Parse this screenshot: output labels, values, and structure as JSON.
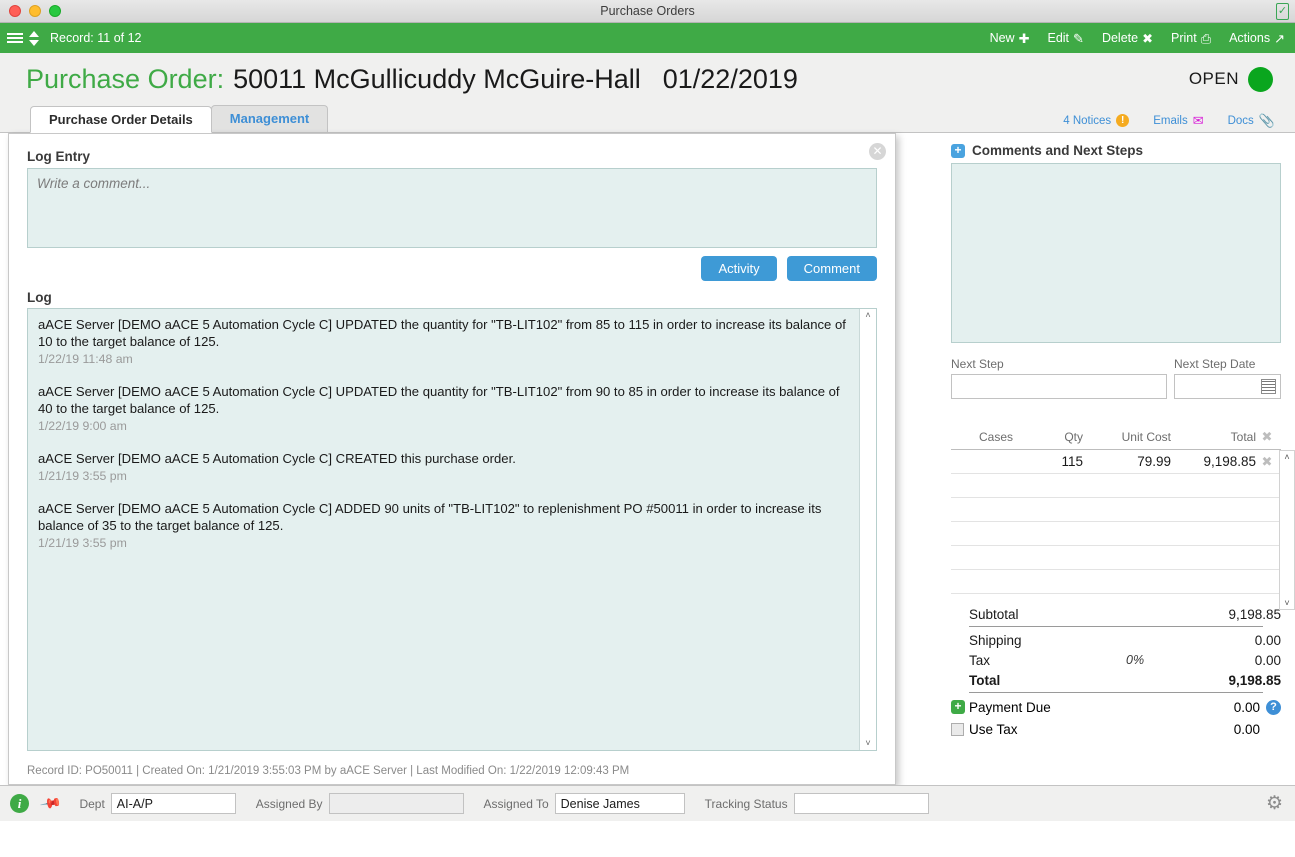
{
  "window": {
    "title": "Purchase Orders",
    "right_icon": "lock-icon"
  },
  "toolbar": {
    "record_label": "Record: 11 of 12",
    "actions": [
      {
        "label": "New",
        "icon": "plus-icon",
        "glyph": "✚"
      },
      {
        "label": "Edit",
        "icon": "pencil-icon",
        "glyph": "✎"
      },
      {
        "label": "Delete",
        "icon": "x-icon",
        "glyph": "✖"
      },
      {
        "label": "Print",
        "icon": "printer-icon",
        "glyph": "⎙"
      },
      {
        "label": "Actions",
        "icon": "arrow-icon",
        "glyph": "↗"
      }
    ]
  },
  "header": {
    "label": "Purchase Order:",
    "number_and_vendor": "50011 McGullicuddy McGuire-Hall",
    "date": "01/22/2019",
    "status": "OPEN",
    "status_color": "#0aa61e"
  },
  "tabs": [
    {
      "label": "Purchase Order Details",
      "active": true
    },
    {
      "label": "Management",
      "active": false
    }
  ],
  "tab_right_items": [
    {
      "label": "4 Notices",
      "icon": "warning-icon",
      "glyph": "!"
    },
    {
      "label": "Emails",
      "icon": "envelope-icon",
      "glyph": "✉"
    },
    {
      "label": "Docs",
      "icon": "paperclip-icon",
      "glyph": "📎"
    }
  ],
  "modal": {
    "close_label": "✕",
    "log_entry_label": "Log Entry",
    "comment_placeholder": "Write a comment...",
    "buttons": [
      {
        "label": "Activity"
      },
      {
        "label": "Comment"
      }
    ],
    "log_label": "Log",
    "log_entries": [
      {
        "text_pre": "aACE",
        "text": " Server [DEMO aACE 5 Automation Cycle C] UPDATED the quantity for \"TB-LIT102\" from 85 to 115 in order to increase its balance of 10 to the target balance of 125.",
        "full": "aACE Server [DEMO aACE 5 Automation Cycle C] UPDATED the quantity for \"TB-LIT102\" from 85 to 115 in order to increase its balance of 10 to the target balance of 125.",
        "timestamp": "1/22/19  11:48 am"
      },
      {
        "full": "aACE Server [DEMO aACE 5 Automation Cycle C] UPDATED the quantity for \"TB-LIT102\" from  90  to 85 in order to increase its balance of 40 to the target balance of 125.",
        "timestamp": "1/22/19  9:00 am"
      },
      {
        "full": "aACE Server [DEMO aACE 5 Automation Cycle C] CREATED this purchase order.",
        "timestamp": "1/21/19  3:55 pm"
      },
      {
        "full": "aACE Server [DEMO aACE 5 Automation Cycle C] ADDED 90 units of \"TB-LIT102\" to replenishment PO #50011 in order to increase its balance of 35 to the target balance of 125.",
        "timestamp": "1/21/19  3:55 pm"
      }
    ],
    "scroll_up": "˄",
    "scroll_down": "˅",
    "record_footer": "Record ID: PO50011  |  Created On: 1/21/2019 3:55:03 PM by aACE Server  |  Last Modified On: 1/22/2019 12:09:43 PM"
  },
  "comments_panel": {
    "title": "Comments and Next Steps",
    "add_glyph": "+",
    "body_value": "",
    "next_step_label": "Next Step",
    "next_step_value": "",
    "next_step_date_label": "Next Step Date",
    "next_step_date_value": "",
    "calendar_icon": "calendar-icon"
  },
  "line_items": {
    "columns": [
      "Cases",
      "Qty",
      "Unit Cost",
      "Total"
    ],
    "delete_glyph": "✖",
    "rows": [
      {
        "cases": "",
        "qty": "115",
        "unit_cost": "79.99",
        "total": "9,198.85"
      },
      {
        "cases": "",
        "qty": "",
        "unit_cost": "",
        "total": ""
      },
      {
        "cases": "",
        "qty": "",
        "unit_cost": "",
        "total": ""
      },
      {
        "cases": "",
        "qty": "",
        "unit_cost": "",
        "total": ""
      },
      {
        "cases": "",
        "qty": "",
        "unit_cost": "",
        "total": ""
      },
      {
        "cases": "",
        "qty": "",
        "unit_cost": "",
        "total": ""
      }
    ],
    "scroll_up": "˄",
    "scroll_down": "˅"
  },
  "totals": {
    "subtotal_label": "Subtotal",
    "subtotal_value": "9,198.85",
    "shipping_label": "Shipping",
    "shipping_value": "0.00",
    "tax_label": "Tax",
    "tax_rate": "0%",
    "tax_value": "0.00",
    "total_label": "Total",
    "total_value": "9,198.85",
    "payment_due_label": "Payment Due",
    "payment_due_value": "0.00",
    "use_tax_label": "Use Tax",
    "use_tax_value": "0.00",
    "help_glyph": "?"
  },
  "bottom_bar": {
    "info_glyph": "i",
    "pin_icon": "pin-icon",
    "dept_label": "Dept",
    "dept_value": "AI-A/P",
    "assigned_by_label": "Assigned By",
    "assigned_by_value": "",
    "assigned_to_label": "Assigned To",
    "assigned_to_value": "Denise James",
    "tracking_status_label": "Tracking Status",
    "tracking_status_value": "",
    "gear_icon": "gear-icon",
    "gear_glyph": "⚙"
  },
  "colors": {
    "toolbar_green": "#3faa46",
    "accent_blue": "#3e9ad6",
    "panel_teal": "#e4f0ef",
    "status_open": "#0aa61e"
  }
}
